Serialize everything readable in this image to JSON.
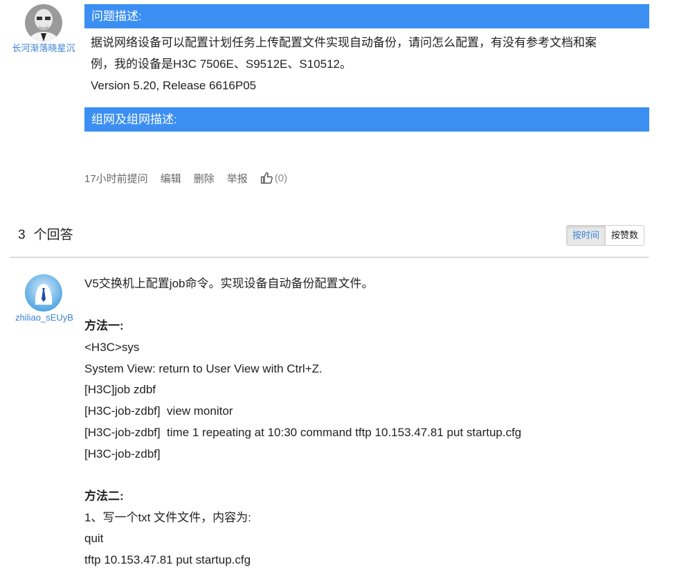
{
  "question": {
    "author": "长河渐落晓星沉",
    "section_problem": "问题描述:",
    "body_lines": [
      "据说网络设备可以配置计划任务上传配置文件实现自动备份，请问怎么配置，有没有参考文档和案",
      "例，我的设备是H3C 7506E、S9512E、S10512。",
      "Version 5.20, Release 6616P05"
    ],
    "section_network": "组网及组网描述:",
    "meta": {
      "time": "17小时前提问",
      "edit": "编辑",
      "delete": "删除",
      "report": "举报",
      "likes": "(0)"
    }
  },
  "answers_header": {
    "count": "3",
    "label": "个回答",
    "sort_time": "按时间",
    "sort_votes": "按赞数"
  },
  "answer": {
    "author": "zhiliao_sEUyB",
    "lines": [
      {
        "text": "V5交换机上配置job命令。实现设备自动备份配置文件。",
        "bold": false
      },
      {
        "text": "",
        "bold": false
      },
      {
        "text": "方法一:",
        "bold": true
      },
      {
        "text": "<H3C>sys",
        "bold": false
      },
      {
        "text": "System View: return to User View with Ctrl+Z.",
        "bold": false
      },
      {
        "text": "[H3C]job zdbf",
        "bold": false
      },
      {
        "text": "[H3C-job-zdbf]  view monitor",
        "bold": false
      },
      {
        "text": "[H3C-job-zdbf]  time 1 repeating at 10:30 command tftp 10.153.47.81 put startup.cfg",
        "bold": false
      },
      {
        "text": "[H3C-job-zdbf]",
        "bold": false
      },
      {
        "text": "",
        "bold": false
      },
      {
        "text": "方法二:",
        "bold": true
      },
      {
        "text": "1、写一个txt 文件文件，内容为:",
        "bold": false
      },
      {
        "text": "quit",
        "bold": false
      },
      {
        "text": "tftp 10.153.47.81 put startup.cfg",
        "bold": false
      }
    ]
  },
  "colors": {
    "section_bar": "#3b8ff3",
    "link": "#3b82d6"
  }
}
